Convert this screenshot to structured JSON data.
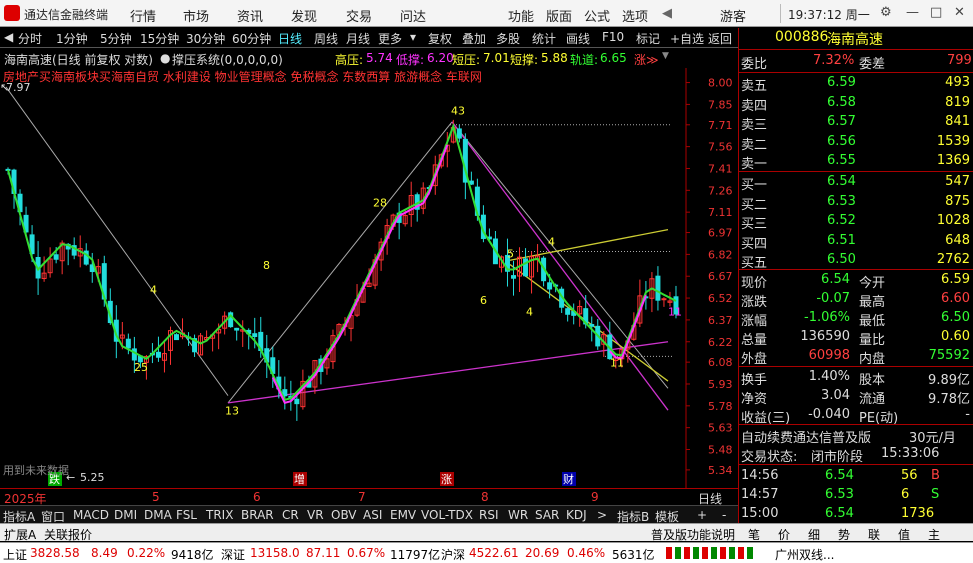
{
  "app": {
    "name": "通达信金融终端",
    "user": "游客",
    "time": "19:37:12 周一"
  },
  "menu": [
    "行情",
    "市场",
    "资讯",
    "发现",
    "交易",
    "问达",
    "功能",
    "版面",
    "公式",
    "选项"
  ],
  "toolbar": {
    "periods": [
      "分时",
      "1分钟",
      "5分钟",
      "15分钟",
      "30分钟",
      "60分钟",
      "日线",
      "周线",
      "月线",
      "更多"
    ],
    "actions": [
      "复权",
      "叠加",
      "多股",
      "统计",
      "画线",
      "F10",
      "标记",
      "+自选",
      "返回"
    ],
    "active": "日线"
  },
  "chart": {
    "title": "海南高速(日线 前复权 对数)",
    "indicator_name": "撑压系统(0,0,0,0,0)",
    "high_pressure": {
      "label": "高压:",
      "value": "5.74"
    },
    "low_support": {
      "label": "低撑:",
      "value": "6.20"
    },
    "short_pressure": {
      "label": "短压:",
      "value": "7.01"
    },
    "short_support": {
      "label": "短撑:",
      "value": "5.88"
    },
    "track": {
      "label": "轨道:",
      "value": "6.65"
    },
    "signal": "涨≫",
    "concepts": "房地产买海南板块买海南自贸 水利建设 物业管理概念 免税概念 东数西算 旅游概念 车联网",
    "future_text": "用到未来数据",
    "max_label": "7.97",
    "min_label": "5.25",
    "y_ticks": [
      "8.00",
      "7.85",
      "7.71",
      "7.56",
      "7.41",
      "7.26",
      "7.11",
      "6.97",
      "6.82",
      "6.67",
      "6.52",
      "6.37",
      "6.22",
      "6.08",
      "5.93",
      "5.78",
      "5.63",
      "5.48",
      "5.34"
    ],
    "wave_labels": [
      "4",
      "25",
      "13",
      "8",
      "28",
      "43",
      "6",
      "5",
      "4",
      "4",
      "11",
      "11"
    ],
    "markers": [
      "跌",
      "增",
      "涨",
      "财"
    ]
  },
  "chart_data": {
    "type": "candlestick",
    "y_range": [
      5.25,
      8.0
    ],
    "x": [
      "2025-04",
      "2025-05",
      "2025-06",
      "2025-07",
      "2025-08",
      "2025-09"
    ],
    "close_trend": [
      7.4,
      6.7,
      6.9,
      6.8,
      6.2,
      6.1,
      6.3,
      6.2,
      6.4,
      6.2,
      5.8,
      6.0,
      6.3,
      6.7,
      7.1,
      7.2,
      7.7,
      7.0,
      6.7,
      6.8,
      6.5,
      6.3,
      6.1,
      6.6,
      6.5
    ]
  },
  "datebar": {
    "year": "2025年",
    "months": [
      "5",
      "6",
      "7",
      "8",
      "9"
    ],
    "period_label": "日线"
  },
  "indicators": [
    "指标A",
    "窗口",
    "MACD",
    "DMI",
    "DMA",
    "FSL",
    "TRIX",
    "BRAR",
    "CR",
    "VR",
    "OBV",
    "ASI",
    "EMV",
    "VOL-TDX",
    "RSI",
    "WR",
    "SAR",
    "KDJ",
    ">",
    "指标B",
    "模板",
    "+",
    "-"
  ],
  "bottom": {
    "left": [
      "扩展A",
      "关联报价"
    ],
    "right": [
      "普及版功能说明",
      "笔",
      "价",
      "细",
      "势",
      "联",
      "值",
      "主"
    ]
  },
  "status": [
    {
      "name": "上证",
      "value": "3828.58",
      "chg": "8.49",
      "pct": "0.22%",
      "amt": "9418亿"
    },
    {
      "name": "深证",
      "value": "13158.0",
      "chg": "87.11",
      "pct": "0.67%",
      "amt": "11797亿"
    },
    {
      "name": "沪深",
      "value": "4522.61",
      "chg": "20.69",
      "pct": "0.46%",
      "amt": "5631亿"
    }
  ],
  "broker": "广州双线...",
  "quote": {
    "code": "000886",
    "name": "海南高速",
    "weibi_label": "委比",
    "weibi": "7.32%",
    "weicha_label": "委差",
    "weicha": "799",
    "asks": [
      {
        "l": "卖五",
        "p": "6.59",
        "v": "493"
      },
      {
        "l": "卖四",
        "p": "6.58",
        "v": "819"
      },
      {
        "l": "卖三",
        "p": "6.57",
        "v": "841"
      },
      {
        "l": "卖二",
        "p": "6.56",
        "v": "1539"
      },
      {
        "l": "卖一",
        "p": "6.55",
        "v": "1369"
      }
    ],
    "bids": [
      {
        "l": "买一",
        "p": "6.54",
        "v": "547"
      },
      {
        "l": "买二",
        "p": "6.53",
        "v": "875"
      },
      {
        "l": "买三",
        "p": "6.52",
        "v": "1028"
      },
      {
        "l": "买四",
        "p": "6.51",
        "v": "648"
      },
      {
        "l": "买五",
        "p": "6.50",
        "v": "2762"
      }
    ],
    "stats": [
      [
        "现价",
        "6.54",
        "今开",
        "6.59"
      ],
      [
        "涨跌",
        "-0.07",
        "最高",
        "6.60"
      ],
      [
        "涨幅",
        "-1.06%",
        "最低",
        "6.50"
      ],
      [
        "总量",
        "136590",
        "量比",
        "0.60"
      ],
      [
        "外盘",
        "60998",
        "内盘",
        "75592"
      ]
    ],
    "stats2": [
      [
        "换手",
        "1.40%",
        "股本",
        "9.89亿"
      ],
      [
        "净资",
        "3.04",
        "流通",
        "9.78亿"
      ],
      [
        "收益(三)",
        "-0.040",
        "PE(动)",
        "-"
      ]
    ],
    "ad": "自动续费通达信普及版",
    "price": "30元/月",
    "trade_state_label": "交易状态:",
    "trade_state": "闭市阶段",
    "trade_time": "15:33:06",
    "ticks": [
      {
        "t": "14:56",
        "p": "6.54",
        "v": "56",
        "s": "B"
      },
      {
        "t": "14:57",
        "p": "6.53",
        "v": "6",
        "s": "S"
      },
      {
        "t": "15:00",
        "p": "6.54",
        "v": "1736",
        "s": ""
      }
    ]
  }
}
